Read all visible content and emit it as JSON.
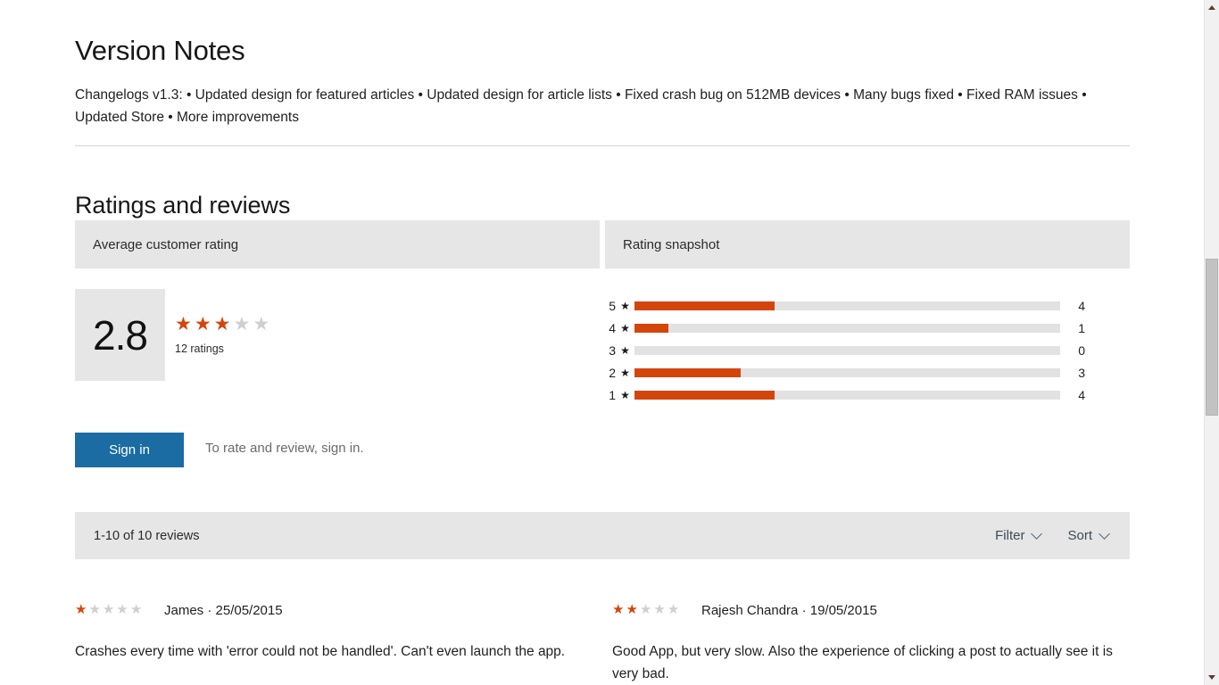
{
  "version_notes": {
    "title": "Version Notes",
    "body": "Changelogs v1.3: • Updated design for featured articles • Updated design for article lists • Fixed crash bug on 512MB devices • Many bugs fixed • Fixed RAM issues • Updated Store • More improvements"
  },
  "ratings": {
    "section_title": "Ratings and reviews",
    "header_left": "Average customer rating",
    "header_right": "Rating snapshot",
    "average_score": "2.8",
    "average_stars_filled": 3,
    "average_stars_total": 5,
    "ratings_count_label": "12 ratings",
    "star_on_color": "#d4450c",
    "star_off_color": "#cfcfcf",
    "snapshot": [
      {
        "stars": "5",
        "star_glyph": "★",
        "count": "4",
        "percent": 33
      },
      {
        "stars": "4",
        "star_glyph": "★",
        "count": "1",
        "percent": 8
      },
      {
        "stars": "3",
        "star_glyph": "★",
        "count": "0",
        "percent": 0
      },
      {
        "stars": "2",
        "star_glyph": "★",
        "count": "3",
        "percent": 25
      },
      {
        "stars": "1",
        "star_glyph": "★",
        "count": "4",
        "percent": 33
      }
    ]
  },
  "signin": {
    "button_label": "Sign in",
    "note": "To rate and review, sign in.",
    "button_color": "#1a6ca3"
  },
  "reviews_toolbar": {
    "count_label": "1-10 of 10 reviews",
    "filter_label": "Filter",
    "sort_label": "Sort"
  },
  "reviews": [
    {
      "author": "James",
      "separator": "·",
      "date": "25/05/2015",
      "stars_filled": 1,
      "text": "Crashes every time with 'error could not be handled'. Can't even launch the app."
    },
    {
      "author": "Rajesh Chandra",
      "separator": "·",
      "date": "19/05/2015",
      "stars_filled": 2,
      "text": "Good App, but very slow. Also the experience of clicking a post to actually see it is very bad."
    }
  ],
  "scrollbar": {
    "up_arrow": "scroll-up",
    "down_arrow": "scroll-down"
  }
}
